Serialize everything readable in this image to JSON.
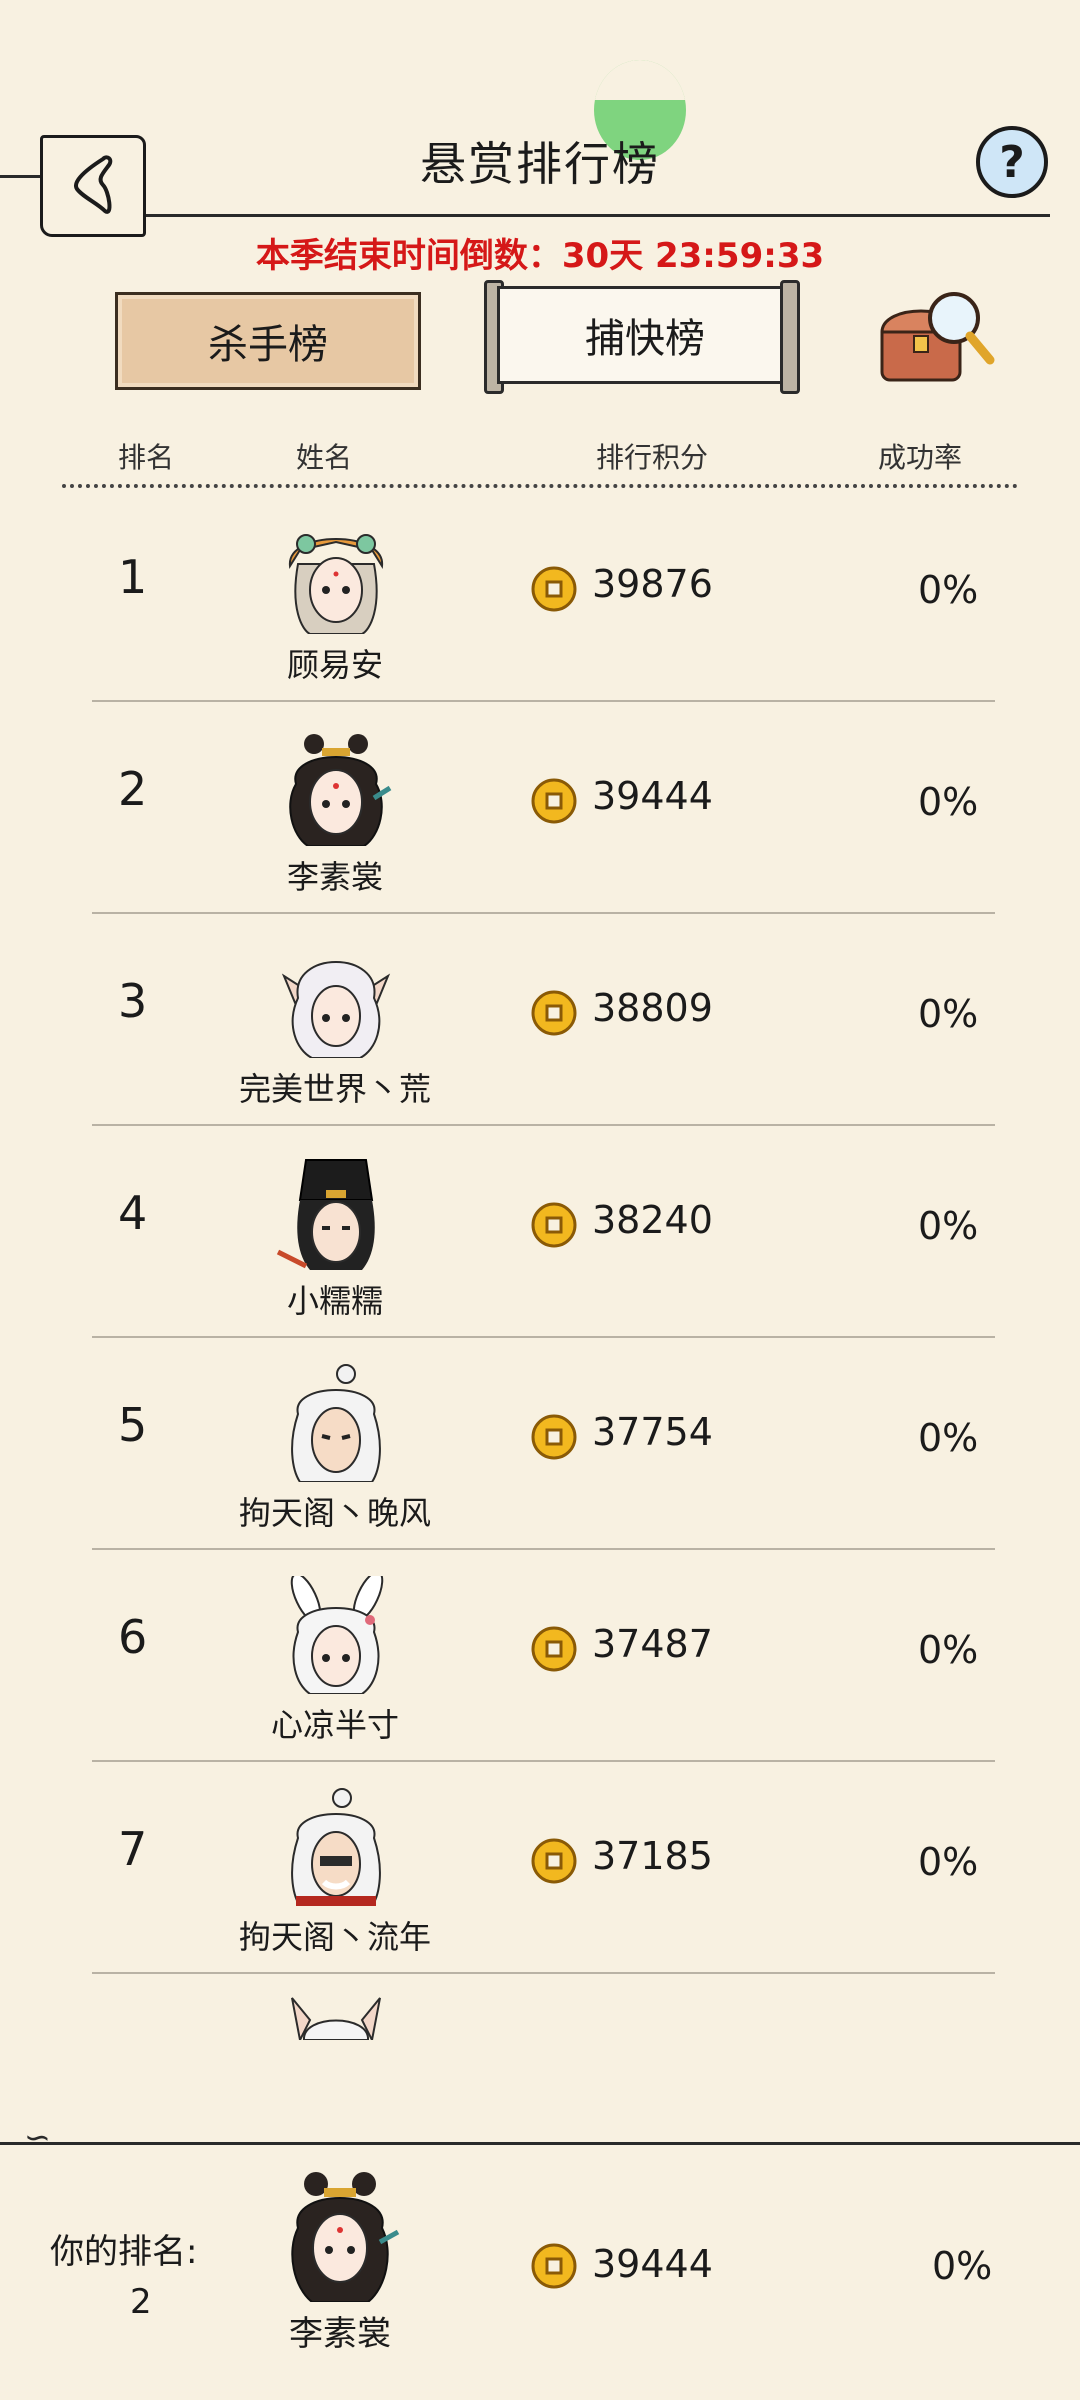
{
  "header": {
    "title": "悬赏排行榜",
    "help": "?",
    "countdown": "本季结束时间倒数：30天 23:59:33"
  },
  "tabs": [
    {
      "label": "杀手榜",
      "active": true
    },
    {
      "label": "捕快榜",
      "active": false
    }
  ],
  "columns": {
    "rank": "排名",
    "name": "姓名",
    "score": "排行积分",
    "rate": "成功率"
  },
  "rows": [
    {
      "rank": "1",
      "name": "顾易安",
      "score": "39876",
      "rate": "0%",
      "avatar": "tiger-hat-girl"
    },
    {
      "rank": "2",
      "name": "李素裳",
      "score": "39444",
      "rate": "0%",
      "avatar": "ornate-hair-lady"
    },
    {
      "rank": "3",
      "name": "完美世界丶荒",
      "score": "38809",
      "rate": "0%",
      "avatar": "fox-ear-white-hair"
    },
    {
      "rank": "4",
      "name": "小糯糯",
      "score": "38240",
      "rate": "0%",
      "avatar": "black-hat-scholar"
    },
    {
      "rank": "5",
      "name": "拘天阁丶晚风",
      "score": "37754",
      "rate": "0%",
      "avatar": "white-hair-man"
    },
    {
      "rank": "6",
      "name": "心凉半寸",
      "score": "37487",
      "rate": "0%",
      "avatar": "bunny-ear-girl"
    },
    {
      "rank": "7",
      "name": "拘天阁丶流年",
      "score": "37185",
      "rate": "0%",
      "avatar": "white-hair-masked"
    }
  ],
  "mine": {
    "label": "你的排名:",
    "rank": "2",
    "name": "李素裳",
    "score": "39444",
    "rate": "0%"
  },
  "colors": {
    "background": "#f8f1e1",
    "countdown": "#d51818",
    "coin": "#f2b81f",
    "tab_active": "#e7c8a4",
    "help": "#cfe6f7"
  }
}
